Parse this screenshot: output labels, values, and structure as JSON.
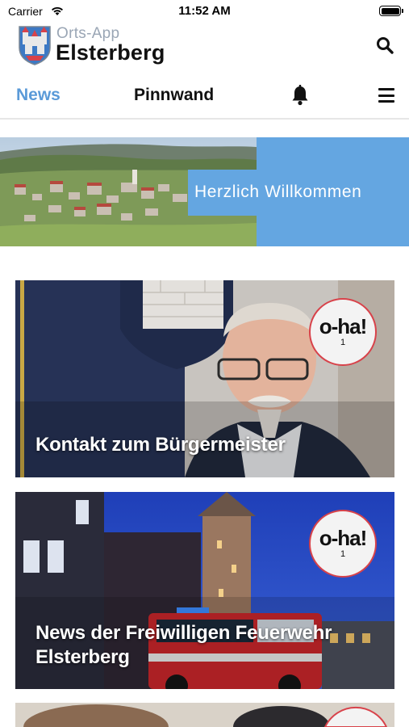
{
  "status_bar": {
    "carrier": "Carrier",
    "time": "11:52 AM"
  },
  "header": {
    "subtitle": "Orts-App",
    "title": "Elsterberg",
    "search_icon": "search-icon"
  },
  "nav": {
    "tabs": [
      {
        "label": "News",
        "active": true
      },
      {
        "label": "Pinnwand",
        "active": false
      }
    ],
    "bell_icon": "bell-icon",
    "menu_icon": "hamburger-menu-icon"
  },
  "banner": {
    "label": "Herzlich Willkommen"
  },
  "cards": [
    {
      "title": "Kontakt zum Bürgermeister",
      "badge": "o-ha!",
      "badge_count": "1"
    },
    {
      "title": "News der Freiwilligen Feuerwehr Elsterberg",
      "badge": "o-ha!",
      "badge_count": "1"
    }
  ],
  "colors": {
    "accent": "#5a9ad8",
    "banner_blue": "#64a6e1",
    "badge_border": "#d8424a"
  }
}
